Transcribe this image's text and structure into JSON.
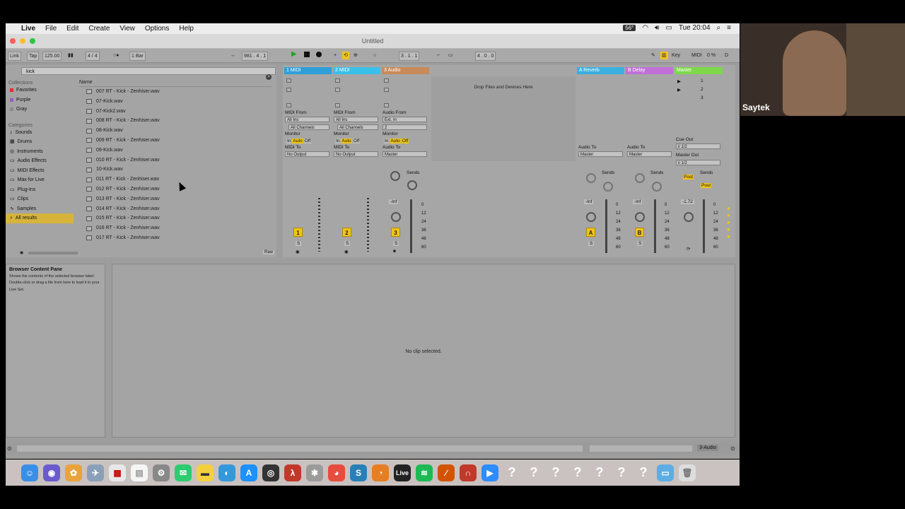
{
  "menubar": {
    "app": "Live",
    "items": [
      "File",
      "Edit",
      "Create",
      "View",
      "Options",
      "Help"
    ],
    "clock": "Tue 20:04",
    "battery_badge": "56°"
  },
  "window": {
    "title": "Untitled"
  },
  "control_bar": {
    "link": "Link",
    "tap": "Tap",
    "tempo": "125.00",
    "time_sig": "4 / 4",
    "quantize": "1 Bar",
    "position": "981 . 4 . 1",
    "loop_start": "3 . 1 . 1",
    "loop_length": "4 . 0 . 0",
    "key": "Key",
    "midi": "MIDI",
    "cpu": "0 %",
    "disk": "D"
  },
  "browser": {
    "search_value": "kick",
    "collections_header": "Collections",
    "collections": [
      {
        "label": "Favorites",
        "color": "#e03030"
      },
      {
        "label": "Purple",
        "color": "#9a5cc8"
      },
      {
        "label": "Gray",
        "color": "#8a8a8a"
      }
    ],
    "categories_header": "Categories",
    "categories": [
      "Sounds",
      "Drums",
      "Instruments",
      "Audio Effects",
      "MIDI Effects",
      "Max for Live",
      "Plug-Ins",
      "Clips",
      "Samples",
      "All results"
    ],
    "column_header": "Name",
    "files": [
      "007 RT - Kick - Zenhiser.wav",
      "07-Kick.wav",
      "07-Kick2.wav",
      "008 RT - Kick - Zenhiser.wav",
      "08-Kick.wav",
      "009 RT - Kick - Zenhiser.wav",
      "09-Kick.wav",
      "010 RT - Kick - Zenhiser.wav",
      "10-Kick.wav",
      "011 RT - Kick - Zenhiser.wav",
      "012 RT - Kick - Zenhiser.wav",
      "013 RT - Kick - Zenhiser.wav",
      "014 RT - Kick - Zenhiser.wav",
      "015 RT - Kick - Zenhiser.wav",
      "016 RT - Kick - Zenhiser.wav",
      "017 RT - Kick - Zenhiser.wav"
    ],
    "preview_raw": "Raw"
  },
  "session": {
    "drop_hint": "Drop Files and Devices Here",
    "tracks": [
      {
        "name": "1 MIDI",
        "color": "#2f9fd8",
        "in_label": "MIDI From",
        "in": "All Ins",
        "ch": "All Channels",
        "out_label": "MIDI To",
        "out": "No Output",
        "number": "1"
      },
      {
        "name": "2 MIDI",
        "color": "#3ac0e8",
        "in_label": "MIDI From",
        "in": "All Ins",
        "ch": "All Channels",
        "out_label": "MIDI To",
        "out": "No Output",
        "number": "2"
      },
      {
        "name": "3 Audio",
        "color": "#c88a5a",
        "in_label": "Audio From",
        "in": "Ext. In",
        "ch": "2",
        "out_label": "Audio To",
        "out": "Master",
        "number": "3"
      }
    ],
    "returns": [
      {
        "name": "A Reverb",
        "color": "#3ab0e0",
        "letter": "A",
        "out": "Master"
      },
      {
        "name": "B Delay",
        "color": "#c070d8",
        "letter": "B",
        "out": "Master"
      }
    ],
    "master": {
      "name": "Master",
      "color": "#7ed84a",
      "cue_label": "Cue Out",
      "cue": "ii 1/2",
      "out_label": "Master Out",
      "out": "ii 1/2",
      "volume": "-1.72"
    },
    "monitor_label": "Monitor",
    "monitor_opts": [
      "In",
      "Auto",
      "Off"
    ],
    "audio_to_label": "Audio To",
    "sends_label": "Sends",
    "post_label": "Post",
    "inf_label": "-Inf",
    "meter_scale": [
      "0",
      "12",
      "24",
      "36",
      "48",
      "60"
    ],
    "solo": "S",
    "scene_numbers": [
      "1",
      "2",
      "3"
    ]
  },
  "info_view": {
    "title": "Browser Content Pane",
    "body": "Shows the contents of the selected browser label. Double-click or drag a file from here to load it in your Live Set."
  },
  "clip_view": {
    "empty_text": "No clip selected."
  },
  "status": {
    "track_label": "3-Audio"
  },
  "webcam": {
    "name": "Saytek"
  }
}
